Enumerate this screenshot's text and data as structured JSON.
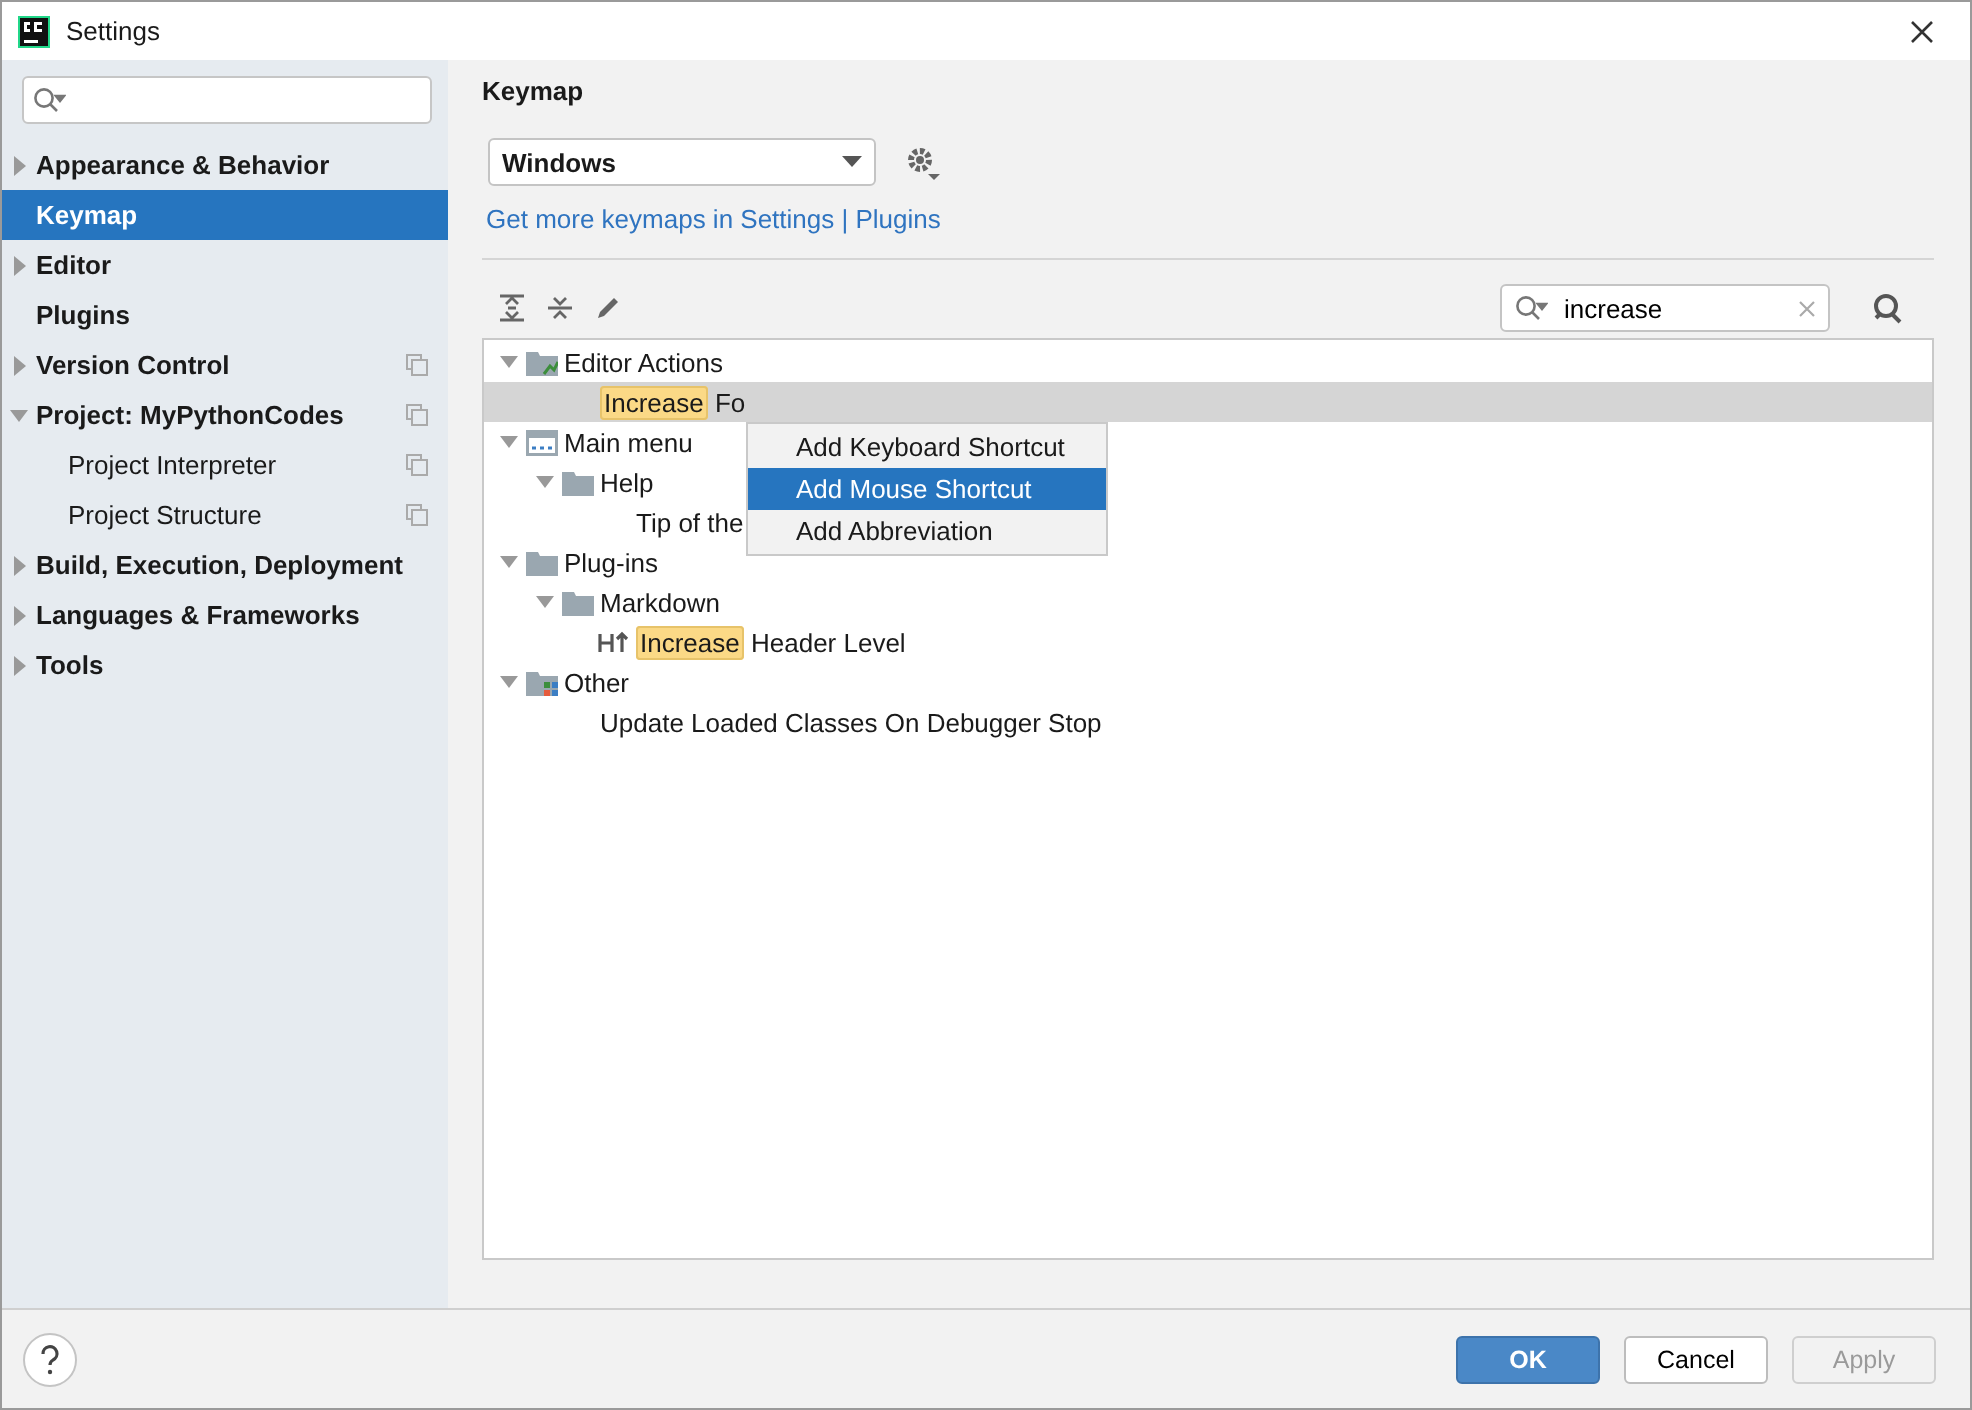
{
  "window": {
    "title": "Settings"
  },
  "sidebar": {
    "items": [
      {
        "label": "Appearance & Behavior",
        "selected": false,
        "expanded": false,
        "project_scoped": false
      },
      {
        "label": "Keymap",
        "selected": true,
        "project_scoped": false
      },
      {
        "label": "Editor",
        "selected": false,
        "expanded": false,
        "project_scoped": false
      },
      {
        "label": "Plugins",
        "selected": false,
        "project_scoped": false
      },
      {
        "label": "Version Control",
        "selected": false,
        "expanded": false,
        "project_scoped": true
      },
      {
        "label": "Project: MyPythonCodes",
        "selected": false,
        "expanded": true,
        "project_scoped": true,
        "children": [
          {
            "label": "Project Interpreter",
            "selected": false,
            "project_scoped": true
          },
          {
            "label": "Project Structure",
            "selected": false,
            "project_scoped": true
          }
        ]
      },
      {
        "label": "Build, Execution, Deployment",
        "selected": false,
        "expanded": false,
        "project_scoped": false
      },
      {
        "label": "Languages & Frameworks",
        "selected": false,
        "expanded": false,
        "project_scoped": false
      },
      {
        "label": "Tools",
        "selected": false,
        "expanded": false,
        "project_scoped": false
      }
    ]
  },
  "keymap": {
    "title": "Keymap",
    "scheme": "Windows",
    "link": "Get more keymaps in Settings | Plugins",
    "filter": {
      "value": "increase"
    },
    "tree": [
      {
        "kind": "editor",
        "parts": [
          {
            "text": "Editor Actions",
            "match": false
          }
        ],
        "expanded": true,
        "selected": false,
        "children": [
          {
            "kind": "action",
            "parts": [
              {
                "text": "Increase",
                "match": true
              },
              {
                "text": " Fo",
                "match": false
              }
            ],
            "selected": true
          }
        ]
      },
      {
        "kind": "menu",
        "parts": [
          {
            "text": "Main menu",
            "match": false
          }
        ],
        "expanded": true,
        "selected": false,
        "children": [
          {
            "kind": "folder",
            "parts": [
              {
                "text": "Help",
                "match": false
              }
            ],
            "expanded": true,
            "selected": false,
            "children": [
              {
                "kind": "action",
                "parts": [
                  {
                    "text": "Tip of the",
                    "match": false
                  }
                ],
                "selected": false
              }
            ]
          }
        ]
      },
      {
        "kind": "folder",
        "parts": [
          {
            "text": "Plug-ins",
            "match": false
          }
        ],
        "expanded": true,
        "selected": false,
        "children": [
          {
            "kind": "folder",
            "parts": [
              {
                "text": "Markdown",
                "match": false
              }
            ],
            "expanded": true,
            "selected": false,
            "children": [
              {
                "kind": "header",
                "parts": [
                  {
                    "text": "Increase",
                    "match": true
                  },
                  {
                    "text": " Header Level",
                    "match": false
                  }
                ],
                "selected": false
              }
            ]
          }
        ]
      },
      {
        "kind": "other",
        "parts": [
          {
            "text": "Other",
            "match": false
          }
        ],
        "expanded": true,
        "selected": false,
        "children": [
          {
            "kind": "action",
            "parts": [
              {
                "text": "Update Loaded Classes On Debugger Stop",
                "match": false
              }
            ],
            "selected": false
          }
        ]
      }
    ],
    "context_menu": [
      {
        "label": "Add Keyboard Shortcut",
        "selected": false
      },
      {
        "label": "Add Mouse Shortcut",
        "selected": true
      },
      {
        "label": "Add Abbreviation",
        "selected": false
      }
    ]
  },
  "buttons": [
    {
      "label": "OK",
      "kind": "primary",
      "disabled": false
    },
    {
      "label": "Cancel",
      "kind": "normal",
      "disabled": false
    },
    {
      "label": "Apply",
      "kind": "normal",
      "disabled": true
    }
  ]
}
